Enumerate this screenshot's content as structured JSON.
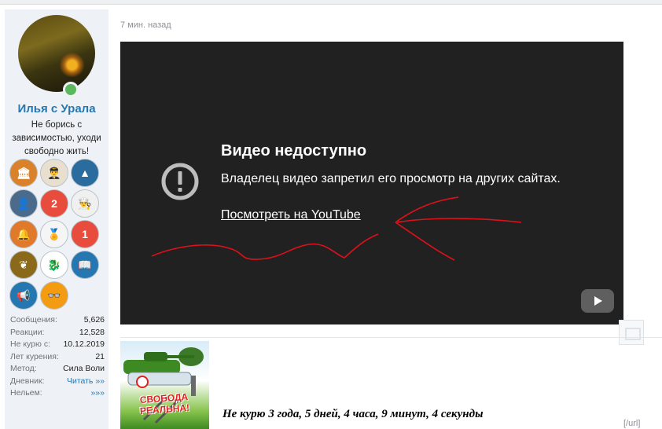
{
  "user": {
    "name": "Илья с Урала",
    "title": "Не борись с зависимостью, уходи свободно жить!",
    "badges": [
      {
        "icon": "column-building-icon",
        "color": "#d9822b",
        "glyph": "🏛"
      },
      {
        "icon": "pilot-icon",
        "color": "#e8dfcf",
        "glyph": "👨‍✈️"
      },
      {
        "icon": "mountain-icon",
        "color": "#2b6c9e",
        "glyph": "▲"
      },
      {
        "icon": "profile-head-icon",
        "color": "#4a6b8c",
        "glyph": "👤"
      },
      {
        "icon": "no-smoking-2-icon",
        "color": "#e84c3d",
        "glyph": "2"
      },
      {
        "icon": "chef-icon",
        "color": "#f0f0f0",
        "glyph": "👨‍🍳"
      },
      {
        "icon": "bells-icon",
        "color": "#e07a2a",
        "glyph": "🔔"
      },
      {
        "icon": "medal-icon",
        "color": "#f5f5f5",
        "glyph": "🏅"
      },
      {
        "icon": "tomato-one-icon",
        "color": "#e74c3c",
        "glyph": "1"
      },
      {
        "icon": "laurel-icon",
        "color": "#8a6a1a",
        "glyph": "❦"
      },
      {
        "icon": "dragon-icon",
        "color": "#ffffff",
        "glyph": "🐉"
      },
      {
        "icon": "book-icon",
        "color": "#2577b1",
        "glyph": "📖"
      },
      {
        "icon": "megaphone-icon",
        "color": "#2577b1",
        "glyph": "📢"
      },
      {
        "icon": "glasses-icon",
        "color": "#f39c12",
        "glyph": "👓"
      }
    ],
    "stats": [
      {
        "label": "Сообщения:",
        "value": "5,626",
        "link": false
      },
      {
        "label": "Реакции:",
        "value": "12,528",
        "link": false
      },
      {
        "label": "Не курю с:",
        "value": "10.12.2019",
        "link": false
      },
      {
        "label": "Лет курения:",
        "value": "21",
        "link": false
      },
      {
        "label": "Метод:",
        "value": "Сила Воли",
        "link": false
      },
      {
        "label": "Дневник:",
        "value": "Читать »»",
        "link": true
      },
      {
        "label": "Нельем:",
        "value": "»»»",
        "link": true
      }
    ]
  },
  "post": {
    "timestamp": "7 мин. назад",
    "video": {
      "title": "Видео недоступно",
      "message": "Владелец видео запретил его просмотр на других сайтах.",
      "link": "Посмотреть на YouTube"
    },
    "signature": {
      "banner_text": "СВОБОДА РЕАЛЬНА!",
      "text": "Не курю  3 года, 5 дней, 4 часа, 9 минут, 4 секунды",
      "url_tag": "[/url]"
    }
  },
  "colors": {
    "link": "#2577b1",
    "video_bg": "#212121",
    "annotation": "#e0101a",
    "online": "#5cb85c"
  }
}
